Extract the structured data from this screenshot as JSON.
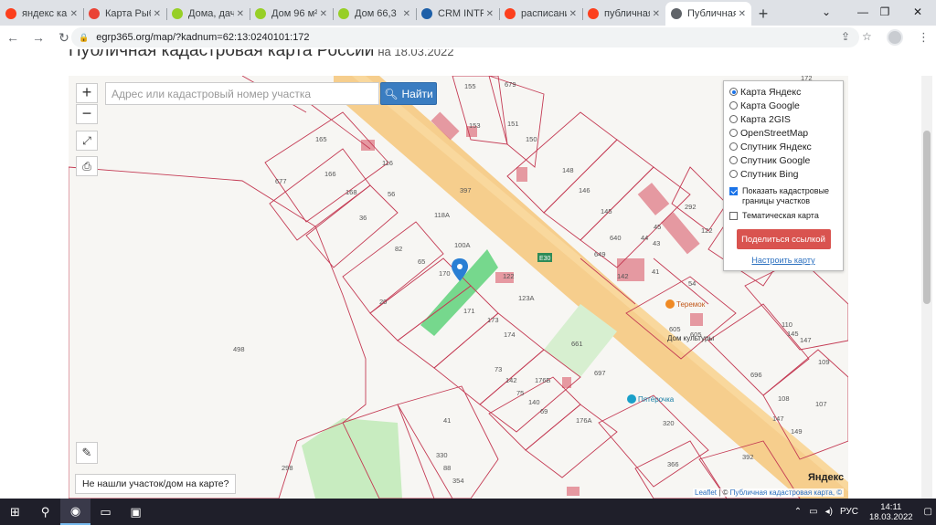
{
  "browser": {
    "tabs": [
      {
        "title": "яндекс карта",
        "icon": "yandex-icon",
        "color": "#fc3f1d"
      },
      {
        "title": "Карта Рыбное",
        "icon": "maps-pin-icon",
        "color": "#ea4335"
      },
      {
        "title": "Дома, дачи",
        "icon": "avito-icon",
        "color": "#97cf26"
      },
      {
        "title": "Дом 96 м²",
        "icon": "avito-icon",
        "color": "#97cf26"
      },
      {
        "title": "Дом 66,3",
        "icon": "avito-icon",
        "color": "#97cf26"
      },
      {
        "title": "CRM INTRUM",
        "icon": "crm-icon",
        "color": "#1d5fa8"
      },
      {
        "title": "расписание",
        "icon": "yandex-icon",
        "color": "#fc3f1d"
      },
      {
        "title": "публичная",
        "icon": "yandex-icon",
        "color": "#fc3f1d"
      },
      {
        "title": "Публичная",
        "icon": "page-icon",
        "color": "#5f6368",
        "active": true
      }
    ],
    "url": "egrp365.org/map/?kadnum=62:13:0240101:172"
  },
  "page": {
    "title": "Публичная кадастровая карта России",
    "date": "на 18.03.2022"
  },
  "map": {
    "search_placeholder": "Адрес или кадастровый номер участка",
    "search_button": "Найти",
    "zoom_in": "+",
    "zoom_out": "−",
    "layers": [
      {
        "label": "Карта Яндекс",
        "checked": true
      },
      {
        "label": "Карта Google",
        "checked": false
      },
      {
        "label": "Карта 2GIS",
        "checked": false
      },
      {
        "label": "OpenStreetMap",
        "checked": false
      },
      {
        "label": "Спутник Яндекс",
        "checked": false
      },
      {
        "label": "Спутник Google",
        "checked": false
      },
      {
        "label": "Спутник Bing",
        "checked": false
      }
    ],
    "show_borders_label": "Показать кадастровые границы участков",
    "show_borders_checked": true,
    "thematic_label": "Тематическая карта",
    "thematic_checked": false,
    "share_button": "Поделиться ссылкой",
    "configure_link": "Настроить карту",
    "not_found_button": "Не нашли участок/дом на карте?",
    "attribution_leaflet": "Leaflet",
    "attribution_sep": " | © ",
    "attribution_source": "Публичная кадастровая карта, ©",
    "yandex_logo": "Яндекс",
    "road_label": "E30",
    "poi": [
      {
        "label": "Теремок"
      },
      {
        "label": "Дом культуры"
      },
      {
        "label": "Пятёрочка"
      }
    ],
    "parcel_numbers": [
      "155",
      "679",
      "153",
      "151",
      "150",
      "165",
      "677",
      "166",
      "168",
      "116",
      "56",
      "36",
      "118А",
      "397",
      "148",
      "146",
      "145",
      "292",
      "122",
      "172",
      "82",
      "170",
      "100А",
      "65",
      "20",
      "122",
      "171",
      "173",
      "174",
      "123А",
      "498",
      "110",
      "145",
      "109",
      "108",
      "147",
      "149",
      "107",
      "696",
      "605",
      "54",
      "41",
      "44",
      "43",
      "605",
      "661",
      "697",
      "73",
      "142",
      "75",
      "140",
      "69",
      "176Б",
      "176А",
      "320",
      "41",
      "330",
      "88",
      "354",
      "298",
      "366",
      "392",
      "45",
      "649",
      "640",
      "147",
      "142"
    ]
  },
  "taskbar": {
    "lang": "РУС",
    "time": "14:11",
    "date": "18.03.2022"
  }
}
